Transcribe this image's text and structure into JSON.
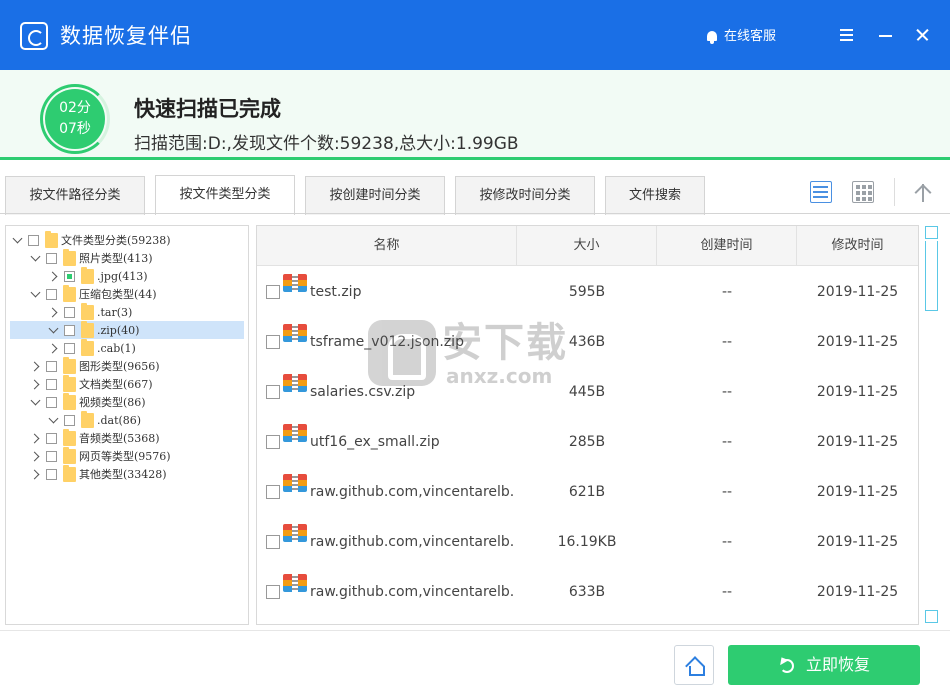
{
  "app": {
    "title": "数据恢复伴侣",
    "online_service": "在线客服"
  },
  "status": {
    "timer_minutes": "02分",
    "timer_seconds": "07秒",
    "title": "快速扫描已完成",
    "summary": "扫描范围:D:,发现文件个数:59238,总大小:1.99GB"
  },
  "tabs": [
    {
      "label": "按文件路径分类",
      "active": false
    },
    {
      "label": "按文件类型分类",
      "active": true
    },
    {
      "label": "按创建时间分类",
      "active": false
    },
    {
      "label": "按修改时间分类",
      "active": false
    },
    {
      "label": "文件搜索",
      "active": false
    }
  ],
  "view_icons": [
    "list-view-icon",
    "grid-view-icon",
    "up-arrow-icon"
  ],
  "tree": [
    {
      "label": "文件类型分类(59238)",
      "expanded": true,
      "level": 0
    },
    {
      "label": "照片类型(413)",
      "expanded": true,
      "level": 1
    },
    {
      "label": ".jpg(413)",
      "expanded": false,
      "level": 2
    },
    {
      "label": "压缩包类型(44)",
      "expanded": true,
      "level": 1
    },
    {
      "label": ".tar(3)",
      "expanded": false,
      "level": 2
    },
    {
      "label": ".zip(40)",
      "expanded": true,
      "level": 2,
      "selected": true
    },
    {
      "label": ".cab(1)",
      "expanded": false,
      "level": 2
    },
    {
      "label": "图形类型(9656)",
      "expanded": false,
      "level": 1
    },
    {
      "label": "文档类型(667)",
      "expanded": false,
      "level": 1
    },
    {
      "label": "视频类型(86)",
      "expanded": true,
      "level": 1
    },
    {
      "label": ".dat(86)",
      "expanded": true,
      "level": 2
    },
    {
      "label": "音频类型(5368)",
      "expanded": false,
      "level": 1
    },
    {
      "label": "网页等类型(9576)",
      "expanded": false,
      "level": 1
    },
    {
      "label": "其他类型(33428)",
      "expanded": false,
      "level": 1
    }
  ],
  "table": {
    "headers": [
      "名称",
      "大小",
      "创建时间",
      "修改时间"
    ],
    "rows": [
      {
        "name": "test.zip",
        "size": "595B",
        "created": "--",
        "modified": "2019-11-25"
      },
      {
        "name": "tsframe_v012.json.zip",
        "size": "436B",
        "created": "--",
        "modified": "2019-11-25"
      },
      {
        "name": "salaries.csv.zip",
        "size": "445B",
        "created": "--",
        "modified": "2019-11-25"
      },
      {
        "name": "utf16_ex_small.zip",
        "size": "285B",
        "created": "--",
        "modified": "2019-11-25"
      },
      {
        "name": "raw.github.com,vincentarelb...",
        "size": "621B",
        "created": "--",
        "modified": "2019-11-25"
      },
      {
        "name": "raw.github.com,vincentarelb...",
        "size": "16.19KB",
        "created": "--",
        "modified": "2019-11-25"
      },
      {
        "name": "raw.github.com,vincentarelb...",
        "size": "633B",
        "created": "--",
        "modified": "2019-11-25"
      }
    ]
  },
  "watermark": {
    "cn": "安下载",
    "en": "anxz.com"
  },
  "footer": {
    "recover_label": "立即恢复"
  },
  "colors": {
    "titlebar": "#1a6fe6",
    "accent_green": "#2ecc71",
    "selected_row": "#cfe4fa"
  }
}
